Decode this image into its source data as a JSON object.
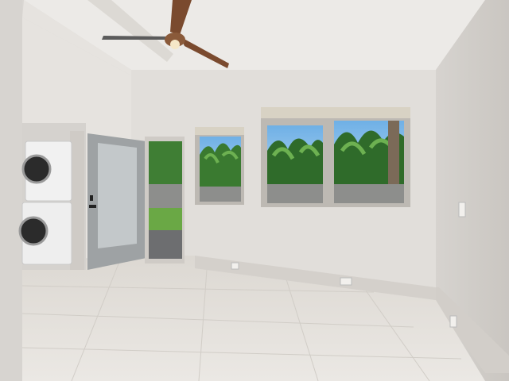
{
  "scene": {
    "kind": "photo",
    "subject": "empty-bedroom-interior",
    "colors": {
      "wall_light": "#e4e1dd",
      "wall_mid": "#d3d0cc",
      "wall_shadow": "#c4c0bb",
      "ceiling": "#eceae7",
      "floor": "#e2dfda",
      "floor_line": "#cfcbc5",
      "beam": "#dcd9d4",
      "fan_wood": "#7a4a2e",
      "fan_metal": "#4a4a4a",
      "window_frame": "#bdb9b3",
      "sky": "#8fc2ea",
      "palm_dark": "#2f6b2a",
      "palm_light": "#5fa14a",
      "stone_wall": "#8d8e8c",
      "grass": "#6aa845",
      "washer": "#f1f1f1",
      "washer_door": "#2b2b2b",
      "door_glass": "#bfc4c6",
      "door_frame": "#9ea2a4"
    }
  }
}
